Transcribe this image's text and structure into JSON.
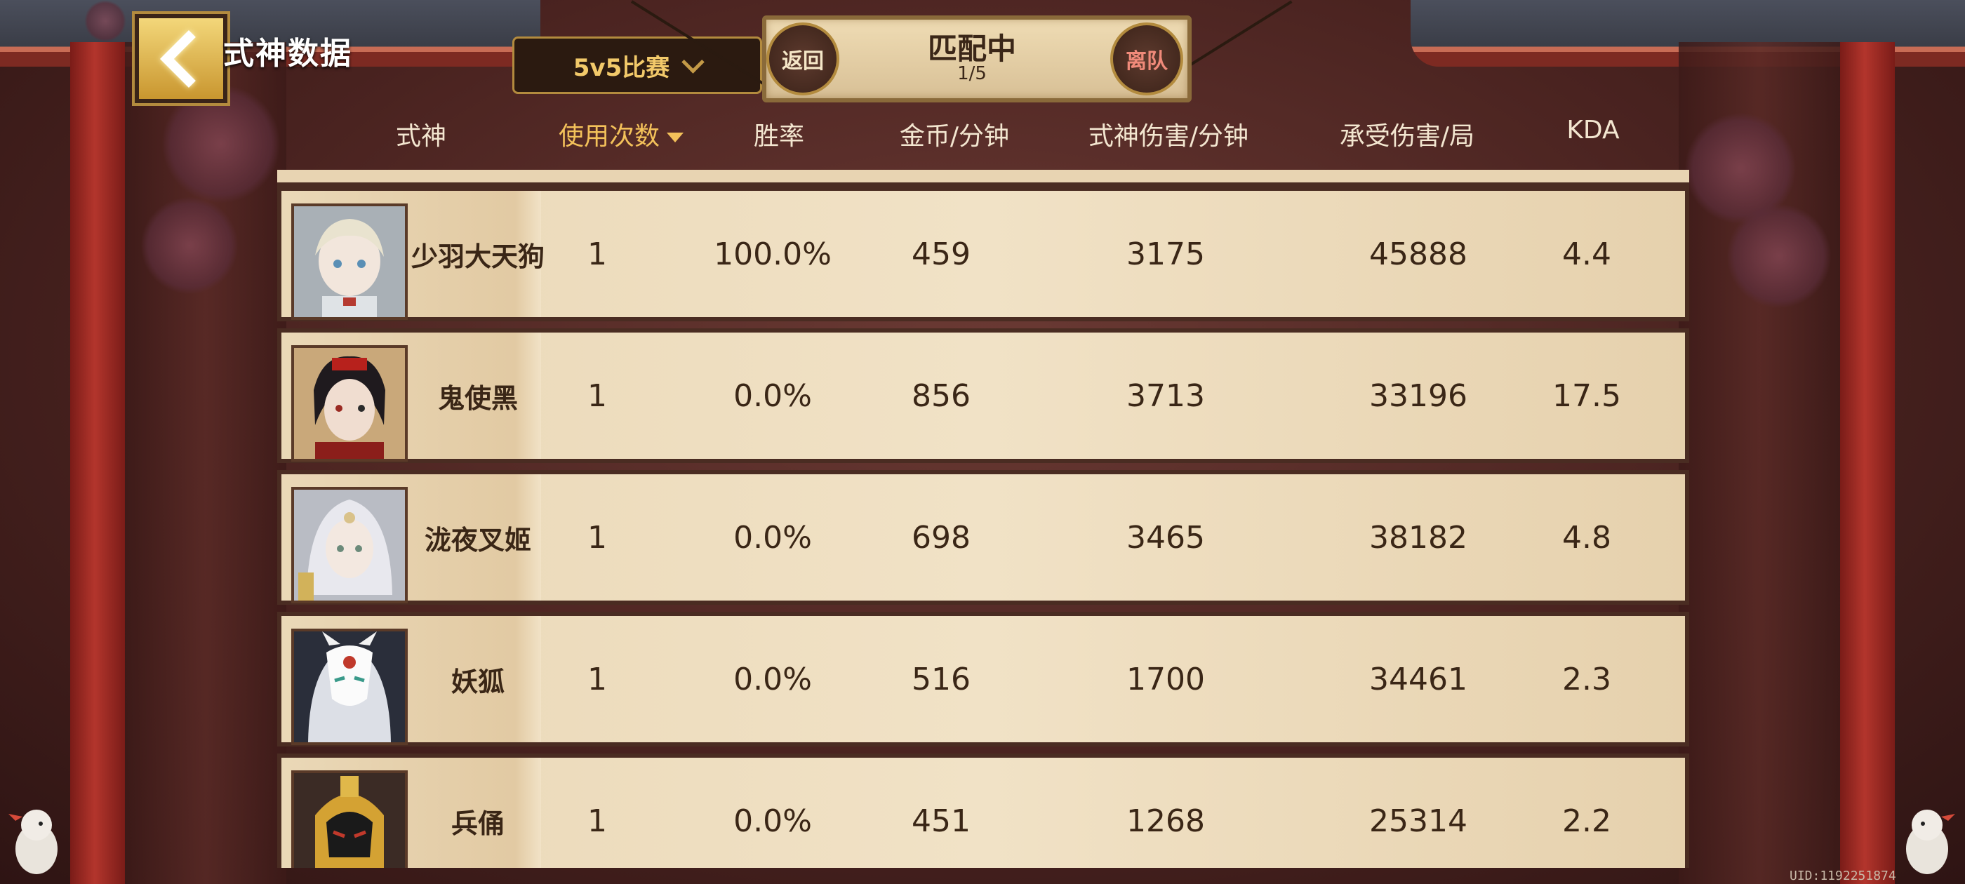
{
  "header": {
    "back_icon": "chevron-left-icon",
    "title": "式神数据",
    "mode_select": {
      "label": "5v5比赛",
      "icon": "chevron-down-icon"
    }
  },
  "match": {
    "status": "匹配中",
    "count": "1/5",
    "return_label": "返回",
    "leave_label": "离队"
  },
  "columns": {
    "shikigami": "式神",
    "uses": "使用次数",
    "winrate": "胜率",
    "gold": "金币/分钟",
    "damage": "式神伤害/分钟",
    "taken": "承受伤害/局",
    "kda": "KDA"
  },
  "rows": [
    {
      "name": "少羽大天狗",
      "uses": "1",
      "winrate": "100.0%",
      "gold": "459",
      "damage": "3175",
      "taken": "45888",
      "kda": "4.4"
    },
    {
      "name": "鬼使黑",
      "uses": "1",
      "winrate": "0.0%",
      "gold": "856",
      "damage": "3713",
      "taken": "33196",
      "kda": "17.5"
    },
    {
      "name": "泷夜叉姬",
      "uses": "1",
      "winrate": "0.0%",
      "gold": "698",
      "damage": "3465",
      "taken": "38182",
      "kda": "4.8"
    },
    {
      "name": "妖狐",
      "uses": "1",
      "winrate": "0.0%",
      "gold": "516",
      "damage": "1700",
      "taken": "34461",
      "kda": "2.3"
    },
    {
      "name": "兵俑",
      "uses": "1",
      "winrate": "0.0%",
      "gold": "451",
      "damage": "1268",
      "taken": "25314",
      "kda": "2.2"
    }
  ],
  "footer": {
    "uid": "UID:1192251874"
  },
  "colors": {
    "accent_gold": "#f3c15a",
    "panel_bg": "#ead8b7",
    "frame_dark": "#4a2c22",
    "text_dark": "#3a2616"
  }
}
